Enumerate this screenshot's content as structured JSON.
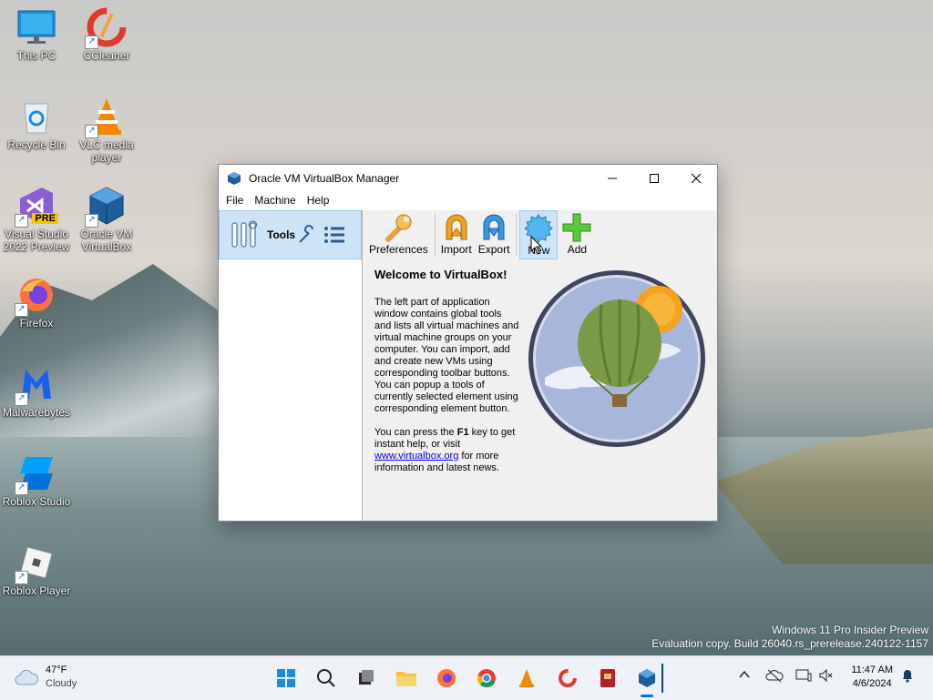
{
  "desktop": {
    "icons": [
      {
        "label": "This PC",
        "icon": "monitor-icon"
      },
      {
        "label": "CCleaner",
        "icon": "ccleaner-icon"
      },
      {
        "label": "Recycle Bin",
        "icon": "recycle-bin-icon"
      },
      {
        "label": "VLC media player",
        "icon": "vlc-icon"
      },
      {
        "label": "Visual Studio 2022 Preview",
        "icon": "visual-studio-icon"
      },
      {
        "label": "Oracle VM VirtualBox",
        "icon": "virtualbox-icon"
      },
      {
        "label": "Firefox",
        "icon": "firefox-icon"
      },
      {
        "label": "Malwarebytes",
        "icon": "malwarebytes-icon"
      },
      {
        "label": "Roblox Studio",
        "icon": "roblox-studio-icon"
      },
      {
        "label": "Roblox Player",
        "icon": "roblox-player-icon"
      }
    ],
    "vs_badge": "PRE",
    "watermark_line1": "Windows 11 Pro Insider Preview",
    "watermark_line2": "Evaluation copy. Build 26040.rs_prerelease.240122-1157"
  },
  "window": {
    "title": "Oracle VM VirtualBox Manager",
    "menu": [
      "File",
      "Machine",
      "Help"
    ],
    "left_pane": {
      "tools_label": "Tools"
    },
    "toolbar": [
      {
        "label": "Preferences",
        "icon": "wrench-icon"
      },
      {
        "label": "Import",
        "icon": "import-arrow-icon"
      },
      {
        "label": "Export",
        "icon": "export-arrow-icon"
      },
      {
        "label": "New",
        "icon": "new-vm-icon"
      },
      {
        "label": "Add",
        "icon": "plus-icon"
      }
    ],
    "welcome": {
      "heading": "Welcome to VirtualBox!",
      "para1": "The left part of application window contains global tools and lists all virtual machines and virtual machine groups on your computer. You can import, add and create new VMs using corresponding toolbar buttons. You can popup a tools of currently selected element using corresponding element button.",
      "para2_pre": "You can press the ",
      "para2_key": "F1",
      "para2_mid": " key to get instant help, or visit ",
      "para2_link": "www.virtualbox.org",
      "para2_post": " for more information and latest news."
    }
  },
  "taskbar": {
    "weather": {
      "temp": "47°F",
      "condition": "Cloudy"
    },
    "clock": {
      "time": "11:47 AM",
      "date": "4/6/2024"
    }
  },
  "colors": {
    "selection": "#cde4f7",
    "accent": "#0078d4"
  }
}
